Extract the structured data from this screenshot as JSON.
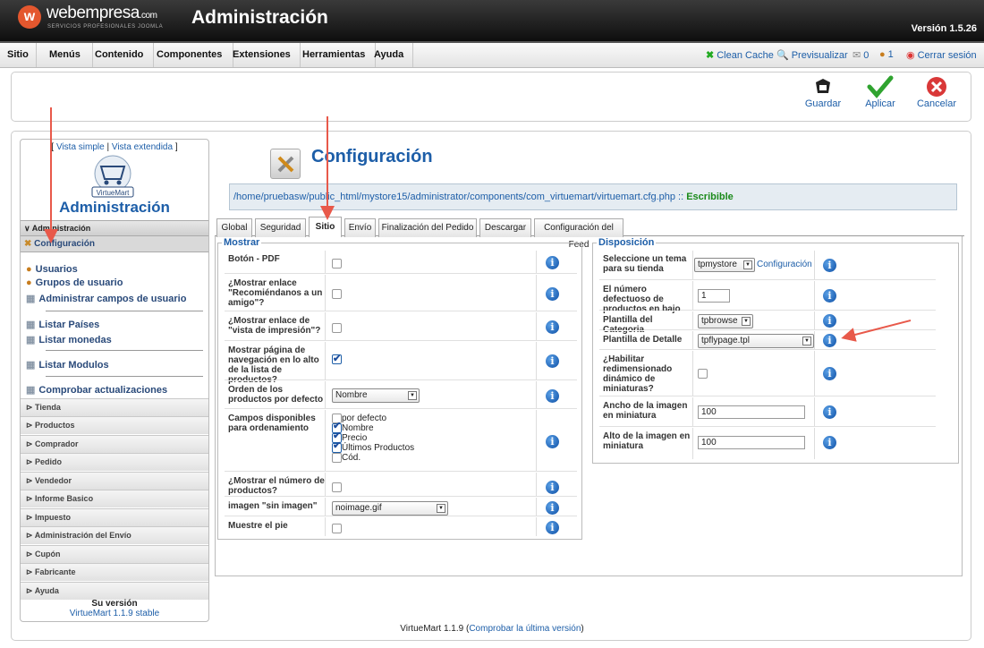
{
  "header": {
    "brand": "webempresa",
    "brand_suffix": ".com",
    "brand_sub": "SERVICIOS PROFESIONALES JOOMLA",
    "title": "Administración",
    "version": "Versión 1.5.26"
  },
  "menu": [
    "Sitio",
    "Menús",
    "Contenido",
    "Componentes",
    "Extensiones",
    "Herramientas",
    "Ayuda"
  ],
  "menu_right": {
    "clean_cache": "Clean Cache",
    "preview": "Previsualizar",
    "messages": "0",
    "users": "1",
    "logout": "Cerrar sesión"
  },
  "toolbar": {
    "save": "Guardar",
    "apply": "Aplicar",
    "cancel": "Cancelar"
  },
  "sidebar": {
    "view_simple": "Vista simple",
    "view_extended": "Vista extendida",
    "view_open": "[ ",
    "view_sep": " | ",
    "view_close": " ]",
    "logo_text": "VirtueMart",
    "title": "Administración",
    "section": "Administración",
    "items": [
      "Configuración",
      "Usuarios",
      "Grupos de usuario",
      "Administrar campos de usuario",
      "Listar Países",
      "Listar monedas",
      "Listar Modulos",
      "Comprobar actualizaciones"
    ],
    "categories": [
      "Tienda",
      "Productos",
      "Comprador",
      "Pedido",
      "Vendedor",
      "Informe Basico",
      "Impuesto",
      "Administración del Envío",
      "Cupón",
      "Fabricante",
      "Ayuda"
    ],
    "your_version": "Su versión",
    "version_value": "VirtueMart 1.1.9 stable"
  },
  "page": {
    "title": "Configuración",
    "path": "/home/pruebasw/public_html/mystore15/administrator/components/com_virtuemart/virtuemart.cfg.php :: ",
    "path_status": "Escribible"
  },
  "tabs": [
    "Global",
    "Seguridad",
    "Sitio",
    "Envío",
    "Finalización del Pedido",
    "Descargar",
    "Configuración del Feed"
  ],
  "active_tab": "Sitio",
  "mostrar": {
    "legend": "Mostrar",
    "pdf": "Botón - PDF",
    "recommend": "¿Mostrar enlace \"Recomiéndanos a un amigo\"?",
    "print": "¿Mostrar enlace de \"vista de impresión\"?",
    "pagenav": "Mostrar página de navegación en lo alto de la lista de productos?",
    "order": "Orden de los productos por defecto",
    "order_value": "Nombre",
    "fields": "Campos disponibles para ordenamiento",
    "field_options": [
      "por defecto",
      "Nombre",
      "Precio",
      "Últimos Productos",
      "Cód."
    ],
    "count": "¿Mostrar el número de productos?",
    "noimage": "imagen \"sin imagen\"",
    "noimage_value": "noimage.gif",
    "footer": "Muestre el pie"
  },
  "disposicion": {
    "legend": "Disposición",
    "theme": "Seleccione un tema para su tienda",
    "theme_value": "tpmystore",
    "theme_link": "Configuración",
    "perrow": "El número defectuoso de productos en bajo",
    "perrow_value": "1",
    "cat_tpl": "Plantilla del Categoria",
    "cat_tpl_value": "tpbrowse",
    "detail_tpl": "Plantilla de Detalle",
    "detail_tpl_value": "tpflypage.tpl",
    "resize": "¿Habilitar redimensionado dinámico de miniaturas?",
    "thumb_w": "Ancho de la imagen en miniatura",
    "thumb_w_value": "100",
    "thumb_h": "Alto de la imagen en miniatura",
    "thumb_h_value": "100"
  },
  "footer": {
    "text": "VirtueMart 1.1.9 (",
    "link": "Comprobar la última versión",
    "close": ")"
  },
  "colors": {
    "accent": "#1d5ea8",
    "header": "#1a1a1a",
    "arrow": "#e8594a",
    "ok": "#1a8a1a"
  }
}
